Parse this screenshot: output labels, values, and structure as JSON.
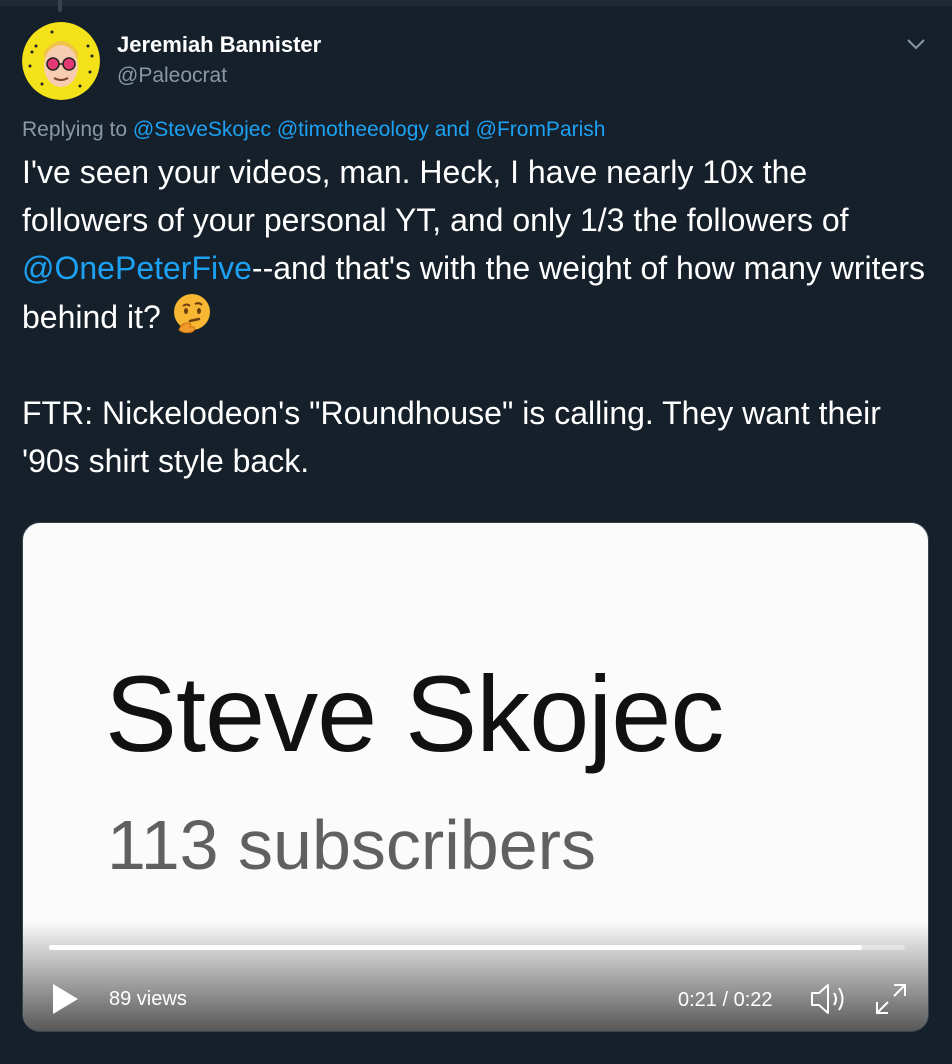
{
  "author": {
    "name": "Jeremiah Bannister",
    "handle": "@Paleocrat"
  },
  "reply": {
    "prefix": "Replying to",
    "mentions": [
      "@SteveSkojec",
      "@timotheeology",
      "@FromParish"
    ],
    "joiner": "and"
  },
  "tweet": {
    "p1_before": "I've seen your videos, man. Heck, I have nearly 10x the followers of your personal YT, and only 1/3 the followers of ",
    "p1_mention": "@OnePeterFive",
    "p1_after": "--and that's with the weight of how many writers behind it?",
    "p1_emoji": "thinking-face-emoji",
    "p2": "FTR: Nickelodeon's \"Roundhouse\" is calling. They want their '90s shirt style back."
  },
  "video": {
    "title": "Steve Skojec",
    "subscribers": "113 subscribers",
    "views": "89 views",
    "time": "0:21 / 0:22",
    "progress_fraction": 0.95
  },
  "colors": {
    "background": "#15202b",
    "accent": "#1da1f2",
    "secondary_text": "#8899a6"
  }
}
